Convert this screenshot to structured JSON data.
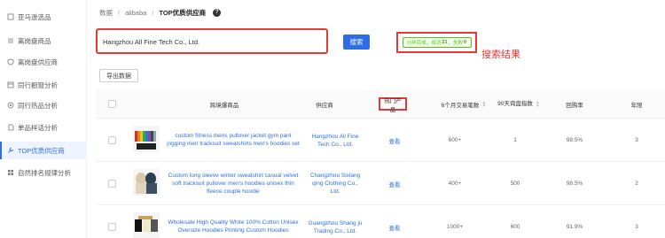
{
  "sidebar": {
    "items": [
      {
        "label": "亚马逊选品",
        "icon": "box-icon",
        "active": false
      },
      {
        "label": "离岗盘商品",
        "icon": "list-icon",
        "active": false
      },
      {
        "label": "离岗盘供应商",
        "icon": "shield-icon",
        "active": false
      },
      {
        "label": "同行橱窗分析",
        "icon": "window-icon",
        "active": false
      },
      {
        "label": "同行热品分析",
        "icon": "target-icon",
        "active": false
      },
      {
        "label": "单品样话分析",
        "icon": "doc-icon",
        "active": false
      },
      {
        "label": "TOP优质供应商",
        "icon": "wrench-icon",
        "active": true
      },
      {
        "label": "自然排名规律分析",
        "icon": "grid-icon",
        "active": false
      }
    ]
  },
  "breadcrumb": {
    "items": [
      "数据",
      "alibaba",
      "TOP优质供应商"
    ],
    "help": "?"
  },
  "search": {
    "value": "Hangzhou All Fine Tech Co., Ltd.",
    "button_label": "搜索"
  },
  "result": {
    "prefix": "分析完成，成功",
    "success_count": "21",
    "middle": "，失败",
    "fail_count": "0",
    "annotation": "搜索结果"
  },
  "toolbar": {
    "export_label": "导出数据"
  },
  "table": {
    "headers": {
      "product": "跨境爆商品",
      "supplier": "供应商",
      "hot": "热门产品",
      "orders_6m": "6个月交易笔数",
      "sales_90d": "90天询盘指数",
      "repurchase": "回购率",
      "years": "年限"
    },
    "rows": [
      {
        "title": "custom fitness mens pullover jacket gym pant jogging men tracksuit sweatshirts men's hoodies set",
        "supplier": "Hangzhou All Fine Tech Co., Ltd.",
        "hot": "查看",
        "orders_6m": "600+",
        "sales_90d": "1",
        "repurchase": "98.5%",
        "years": "3"
      },
      {
        "title": "Custom long sleeve winter sweatshirt casual velvet soft tracksuit pullover men's hoodies unisex thin fleece couple hoodie",
        "supplier": "Changzhou Sixiang qing Clothing Co., Ltd.",
        "hot": "查看",
        "orders_6m": "400+",
        "sales_90d": "500",
        "repurchase": "98.5%",
        "years": "2"
      },
      {
        "title": "Wholesale High Quality White 100% Cotton Unisex Oversize Hoodies Printing Custom Hoodies",
        "supplier": "Guangzhou Shang ju Trading Co., Ltd.",
        "hot": "查看",
        "orders_6m": "1000+",
        "sales_90d": "600",
        "repurchase": "91.9%",
        "years": "3"
      }
    ]
  },
  "colors": {
    "accent": "#2d6ee8",
    "highlight": "#e53935",
    "success": "#52c41a"
  }
}
